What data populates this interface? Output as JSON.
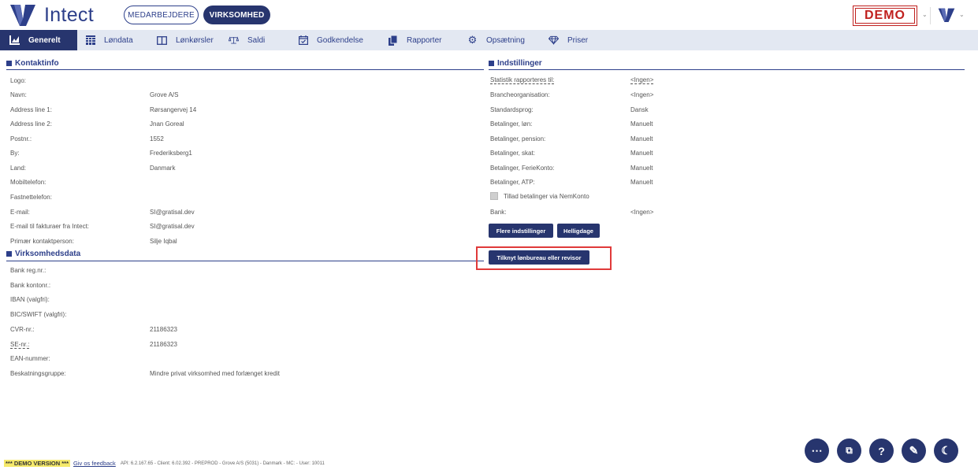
{
  "header": {
    "app_name": "Intect",
    "tab_employees": "MEDARBEJDERE",
    "tab_company": "VIRKSOMHED",
    "demo_badge": "DEMO",
    "brand_color": "#27356e",
    "demo_color": "#c0201e"
  },
  "nav": {
    "items": [
      {
        "label": "Generelt",
        "icon": "chart-icon",
        "active": true
      },
      {
        "label": "Løndata",
        "icon": "grid-icon"
      },
      {
        "label": "Lønkørsler",
        "icon": "book-icon"
      },
      {
        "label": "Saldi",
        "icon": "scale-icon"
      },
      {
        "label": "Godkendelse",
        "icon": "calendar-check-icon"
      },
      {
        "label": "Rapporter",
        "icon": "copy-icon"
      },
      {
        "label": "Opsætning",
        "icon": "gear-icon"
      },
      {
        "label": "Priser",
        "icon": "diamond-icon"
      }
    ]
  },
  "contact": {
    "title": "Kontaktinfo",
    "rows": [
      {
        "label": "Logo:",
        "value": ""
      },
      {
        "label": "Navn:",
        "value": "Grove A/S"
      },
      {
        "label": "Address line 1:",
        "value": "Rørsangervej 14"
      },
      {
        "label": "Address line 2:",
        "value": "Jnan Goreal"
      },
      {
        "label": "Postnr.:",
        "value": "1552"
      },
      {
        "label": "By:",
        "value": "Frederiksberg1"
      },
      {
        "label": "Land:",
        "value": "Danmark"
      },
      {
        "label": "Mobiltelefon:",
        "value": ""
      },
      {
        "label": "Fastnettelefon:",
        "value": ""
      },
      {
        "label": "E-mail:",
        "value": "SI@gratisal.dev"
      },
      {
        "label": "E-mail til fakturaer fra Intect:",
        "value": "SI@gratisal.dev"
      },
      {
        "label": "Primær kontaktperson:",
        "value": "Silje Iqbal"
      }
    ]
  },
  "company": {
    "title": "Virksomhedsdata",
    "rows": [
      {
        "label": "Bank reg.nr.:",
        "value": ""
      },
      {
        "label": "Bank kontonr.:",
        "value": ""
      },
      {
        "label": "IBAN (valgfri):",
        "value": ""
      },
      {
        "label": "BIC/SWIFT (valgfri):",
        "value": ""
      },
      {
        "label": "CVR-nr.:",
        "value": "21186323"
      },
      {
        "label": "SE-nr.:",
        "value": "21186323"
      },
      {
        "label": "EAN-nummer:",
        "value": ""
      },
      {
        "label": "Beskatningsgruppe:",
        "value": "Mindre privat virksomhed med forlænget kredit"
      }
    ]
  },
  "settings": {
    "title": "Indstillinger",
    "rows": [
      {
        "label": "Statistik rapporteres til:",
        "value": "<Ingen>"
      },
      {
        "label": "Brancheorganisation:",
        "value": "<Ingen>"
      },
      {
        "label": "Standardsprog:",
        "value": "Dansk"
      },
      {
        "label": "Betalinger, løn:",
        "value": "Manuelt"
      },
      {
        "label": "Betalinger, pension:",
        "value": "Manuelt"
      },
      {
        "label": "Betalinger, skat:",
        "value": "Manuelt"
      },
      {
        "label": "Betalinger, FerieKonto:",
        "value": "Manuelt"
      },
      {
        "label": "Betalinger, ATP:",
        "value": "Manuelt"
      }
    ],
    "checkbox_label": "Tillad betalinger via NemKonto",
    "bank_label": "Bank:",
    "bank_value": "<Ingen>",
    "btn_more": "Flere indstillinger",
    "btn_holidays": "Helligdage",
    "btn_link": "Tilknyt lønbureau eller revisor"
  },
  "footer": {
    "demo_version": "*** DEMO VERSION ***",
    "feedback": "Giv os feedback",
    "info": "API: 6.2.167.65 - Client: 6.02.392 - PREPROD - Grove A/S (5031) - Danmark - MC:  - User: 10011"
  },
  "fabs": [
    {
      "icon": "more-icon",
      "glyph": "⋯"
    },
    {
      "icon": "copy-icon",
      "glyph": "⧉"
    },
    {
      "icon": "help-icon",
      "glyph": "?"
    },
    {
      "icon": "edit-icon",
      "glyph": "✎"
    },
    {
      "icon": "dark-mode-icon",
      "glyph": "☾"
    }
  ]
}
